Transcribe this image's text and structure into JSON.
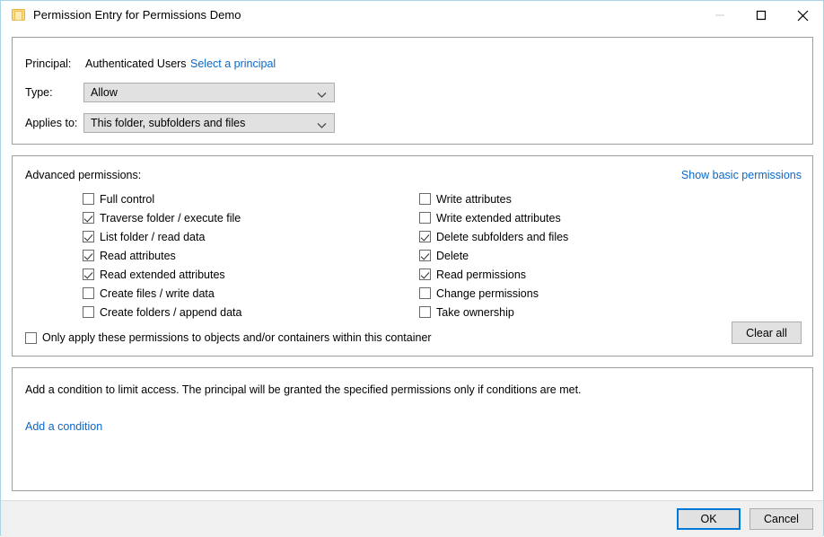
{
  "window": {
    "title": "Permission Entry for Permissions Demo",
    "icon": "folder-icon",
    "controls": {
      "minimize": "minimize-icon",
      "maximize": "maximize-icon",
      "close": "close-icon"
    }
  },
  "principal": {
    "principal_label": "Principal:",
    "principal_value": "Authenticated Users",
    "select_principal_link": "Select a principal",
    "type_label": "Type:",
    "type_value": "Allow",
    "applies_to_label": "Applies to:",
    "applies_to_value": "This folder, subfolders and files"
  },
  "permissions": {
    "heading": "Advanced permissions:",
    "toggle_link": "Show basic permissions",
    "left_column": [
      {
        "label": "Full control",
        "checked": false
      },
      {
        "label": "Traverse folder / execute file",
        "checked": true
      },
      {
        "label": "List folder / read data",
        "checked": true
      },
      {
        "label": "Read attributes",
        "checked": true
      },
      {
        "label": "Read extended attributes",
        "checked": true
      },
      {
        "label": "Create files / write data",
        "checked": false
      },
      {
        "label": "Create folders / append data",
        "checked": false
      }
    ],
    "right_column": [
      {
        "label": "Write attributes",
        "checked": false
      },
      {
        "label": "Write extended attributes",
        "checked": false
      },
      {
        "label": "Delete subfolders and files",
        "checked": true
      },
      {
        "label": "Delete",
        "checked": true
      },
      {
        "label": "Read permissions",
        "checked": true
      },
      {
        "label": "Change permissions",
        "checked": false
      },
      {
        "label": "Take ownership",
        "checked": false
      }
    ],
    "only_apply": {
      "label": "Only apply these permissions to objects and/or containers within this container",
      "checked": false
    },
    "clear_all_label": "Clear all"
  },
  "conditions": {
    "description": "Add a condition to limit access. The principal will be granted the specified permissions only if conditions are met.",
    "add_link": "Add a condition"
  },
  "footer": {
    "ok_label": "OK",
    "cancel_label": "Cancel"
  },
  "colors": {
    "link": "#0b68c8",
    "focus_border": "#0078d7",
    "window_border": "#a8d5e2",
    "control_face": "#e1e1e1",
    "footer_bg": "#f0f0f0"
  }
}
